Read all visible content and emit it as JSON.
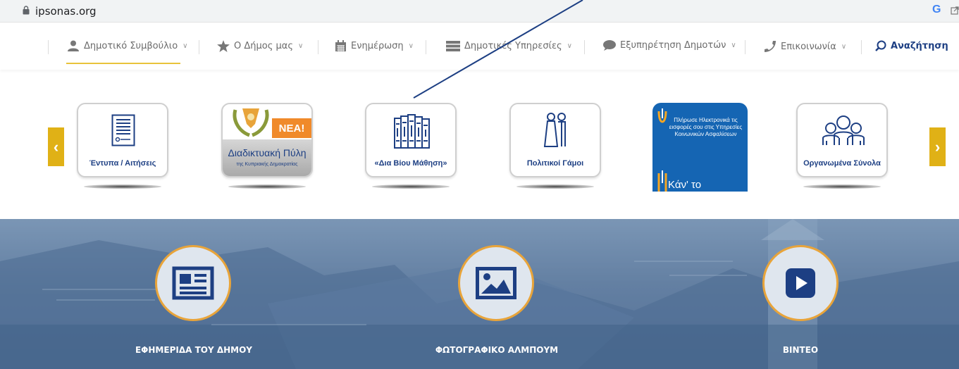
{
  "browser": {
    "url": "ipsonas.org"
  },
  "nav": {
    "items": [
      {
        "label": "Δημοτικό Συμβούλιο",
        "icon": "user-icon"
      },
      {
        "label": "Ο Δήμος μας",
        "icon": "star-icon"
      },
      {
        "label": "Ενημέρωση",
        "icon": "calendar-icon"
      },
      {
        "label": "Δημοτικές Υπηρεσίες",
        "icon": "list-icon"
      },
      {
        "label": "Εξυπηρέτηση Δημοτών",
        "icon": "chat-bubble-icon"
      },
      {
        "label": "Επικοινωνία",
        "icon": "phone-icon"
      }
    ],
    "search_label": "Αναζήτηση"
  },
  "carousel": {
    "prev": "‹",
    "next": "›",
    "cards": [
      {
        "label": "Έντυπα / Αιτήσεις"
      },
      {
        "badge": "ΝΕΑ!",
        "title": "Διαδικτυακή Πύλη",
        "subtitle": "της Κυπριακής Δημοκρατίας"
      },
      {
        "label": "«Δια Βίου Μάθηση»"
      },
      {
        "label": "Πολιτικοί Γάμοι"
      },
      {
        "text": "Πλήρωσε Ηλεκτρονικά τις εισφορές σου στις Υπηρεσίες Κοινωνικών Ασφαλίσεων",
        "cta": "Κάν' το"
      },
      {
        "label": "Οργανωμένα Σύνολα"
      }
    ]
  },
  "hero": {
    "links": [
      {
        "label": "ΕΦΗΜΕΡΙΔΑ ΤΟΥ ΔΗΜΟΥ",
        "icon": "newspaper-icon"
      },
      {
        "label": "ΦΩΤΟΓΡΑΦΙΚΟ ΑΛΜΠΟΥΜ",
        "icon": "image-icon"
      },
      {
        "label": "ΒΙΝΤΕΟ",
        "icon": "play-icon"
      }
    ]
  },
  "colors": {
    "navy": "#1d3f83",
    "accent_yellow": "#e0b116",
    "ring_orange": "#e8a43a",
    "banner_blue": "#1565b3"
  }
}
